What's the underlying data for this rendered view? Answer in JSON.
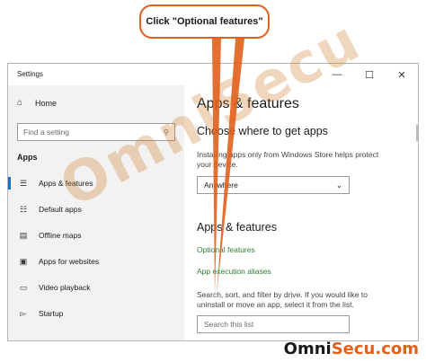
{
  "callout": {
    "text": "Click \"Optional features\""
  },
  "window": {
    "title": "Settings",
    "controls": {
      "minimize": "—",
      "maximize": "☐",
      "close": "✕"
    }
  },
  "sidebar": {
    "home_label": "Home",
    "search_placeholder": "Find a setting",
    "section_label": "Apps",
    "items": [
      {
        "label": "Apps & features",
        "icon": "list-icon",
        "active": true
      },
      {
        "label": "Default apps",
        "icon": "default-apps-icon",
        "active": false
      },
      {
        "label": "Offline maps",
        "icon": "map-icon",
        "active": false
      },
      {
        "label": "Apps for websites",
        "icon": "web-icon",
        "active": false
      },
      {
        "label": "Video playback",
        "icon": "video-icon",
        "active": false
      },
      {
        "label": "Startup",
        "icon": "startup-icon",
        "active": false
      }
    ]
  },
  "main": {
    "title": "Apps & features",
    "choose_heading": "Choose where to get apps",
    "choose_text": "Installing apps only from Windows Store helps protect your device.",
    "dropdown_value": "Anywhere",
    "apps_heading": "Apps & features",
    "link_optional": "Optional features",
    "link_aliases": "App execution aliases",
    "search_text": "Search, sort, and filter by drive. If you would like to uninstall or move an app, select it from the list.",
    "search_placeholder": "Search this list"
  },
  "watermark": "OmniSecu",
  "brand": {
    "part1": "Omni",
    "part2": "Secu.com"
  },
  "colors": {
    "accent": "#0078d7",
    "link": "#2f7d32",
    "callout_border": "#e0601c"
  }
}
